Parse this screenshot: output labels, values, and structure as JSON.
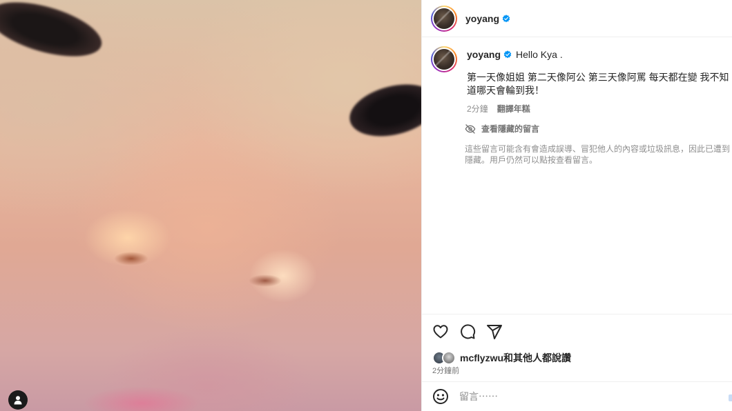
{
  "media": {
    "user_tag_icon": "person-icon"
  },
  "header": {
    "username": "yoyang",
    "verified_icon": "verified-badge-icon"
  },
  "caption": {
    "username": "yoyang",
    "title": "Hello Kya .",
    "body": "第一天像姐姐 第二天像阿公 第三天像阿罵 每天都在變 我不知道哪天會輪到我！",
    "time": "2分鐘",
    "translate_label": "翻譯年糕"
  },
  "hidden_comments": {
    "link_label": "查看隱藏的留言",
    "icon": "eye-slash-icon",
    "note": "這些留言可能含有會造成誤導、冒犯他人的內容或垃圾訊息，因此已遭到隱藏。用戶仍然可以點按查看留言。"
  },
  "actions": {
    "like_icon": "heart-icon",
    "comment_icon": "comment-icon",
    "share_icon": "send-icon"
  },
  "likes": {
    "user": "mcflyzwu",
    "suffix": "和其他人都說讚",
    "time": "2分鐘前"
  },
  "comment_box": {
    "emoji_icon": "emoji-icon",
    "placeholder": "留言⋯⋯"
  },
  "colors": {
    "verified": "#0095f6",
    "text": "#262626",
    "muted": "#8e8e8e"
  }
}
